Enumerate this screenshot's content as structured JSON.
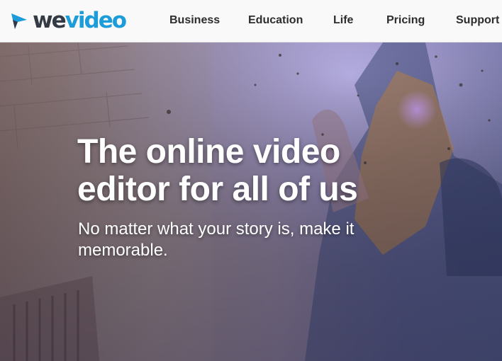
{
  "header": {
    "logo": {
      "part1": "we",
      "part2": "video",
      "icon": "play-arrow-icon"
    },
    "nav": {
      "business": "Business",
      "education": "Education",
      "life": "Life",
      "pricing": "Pricing",
      "support": "Support"
    }
  },
  "hero": {
    "title": "The online video editor for all of us",
    "subtitle": "No matter what your story is, make it memorable."
  },
  "colors": {
    "brand_dark": "#333a44",
    "brand_blue": "#1c9cd8",
    "nav_text": "#2d2d2d",
    "hero_text": "#ffffff"
  }
}
